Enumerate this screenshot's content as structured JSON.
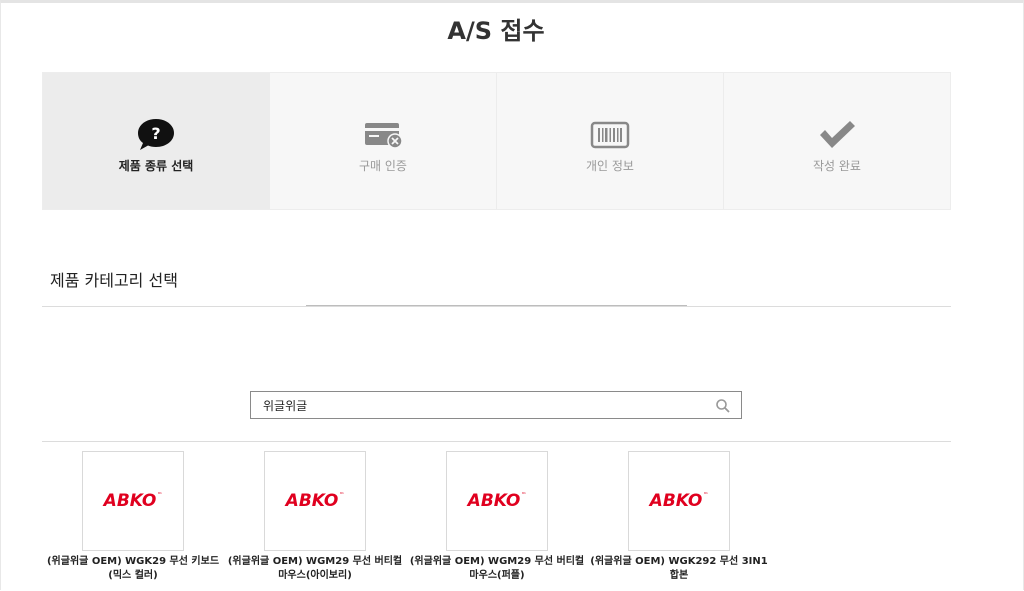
{
  "page": {
    "title": "A/S 접수"
  },
  "steps": [
    {
      "label": "제품 종류 선택",
      "icon": "question-bubble-icon",
      "active": true
    },
    {
      "label": "구매 인증",
      "icon": "card-cancel-icon",
      "active": false
    },
    {
      "label": "개인 정보",
      "icon": "barcode-icon",
      "active": false
    },
    {
      "label": "작성 완료",
      "icon": "checkmark-icon",
      "active": false
    }
  ],
  "section": {
    "title": "제품 카테고리 선택"
  },
  "search": {
    "value": "위글위글",
    "placeholder": "",
    "icon": "search-icon"
  },
  "products": [
    {
      "logo": "ABKO",
      "logo_tm": "™",
      "name": "(위글위글 OEM) WGK29 무선 키보드(믹스 컬러)"
    },
    {
      "logo": "ABKO",
      "logo_tm": "™",
      "name": "(위글위글 OEM) WGM29 무선 버티컬 마우스(아이보리)"
    },
    {
      "logo": "ABKO",
      "logo_tm": "™",
      "name": "(위글위글 OEM) WGM29 무선 버티컬 마우스(퍼플)"
    },
    {
      "logo": "ABKO",
      "logo_tm": "™",
      "name": "(위글위글 OEM) WGK292 무선 3IN1 합본"
    }
  ],
  "colors": {
    "brand_red": "#e0001f",
    "active_step_bg": "#ececec",
    "step_bg": "#f7f7f7"
  }
}
